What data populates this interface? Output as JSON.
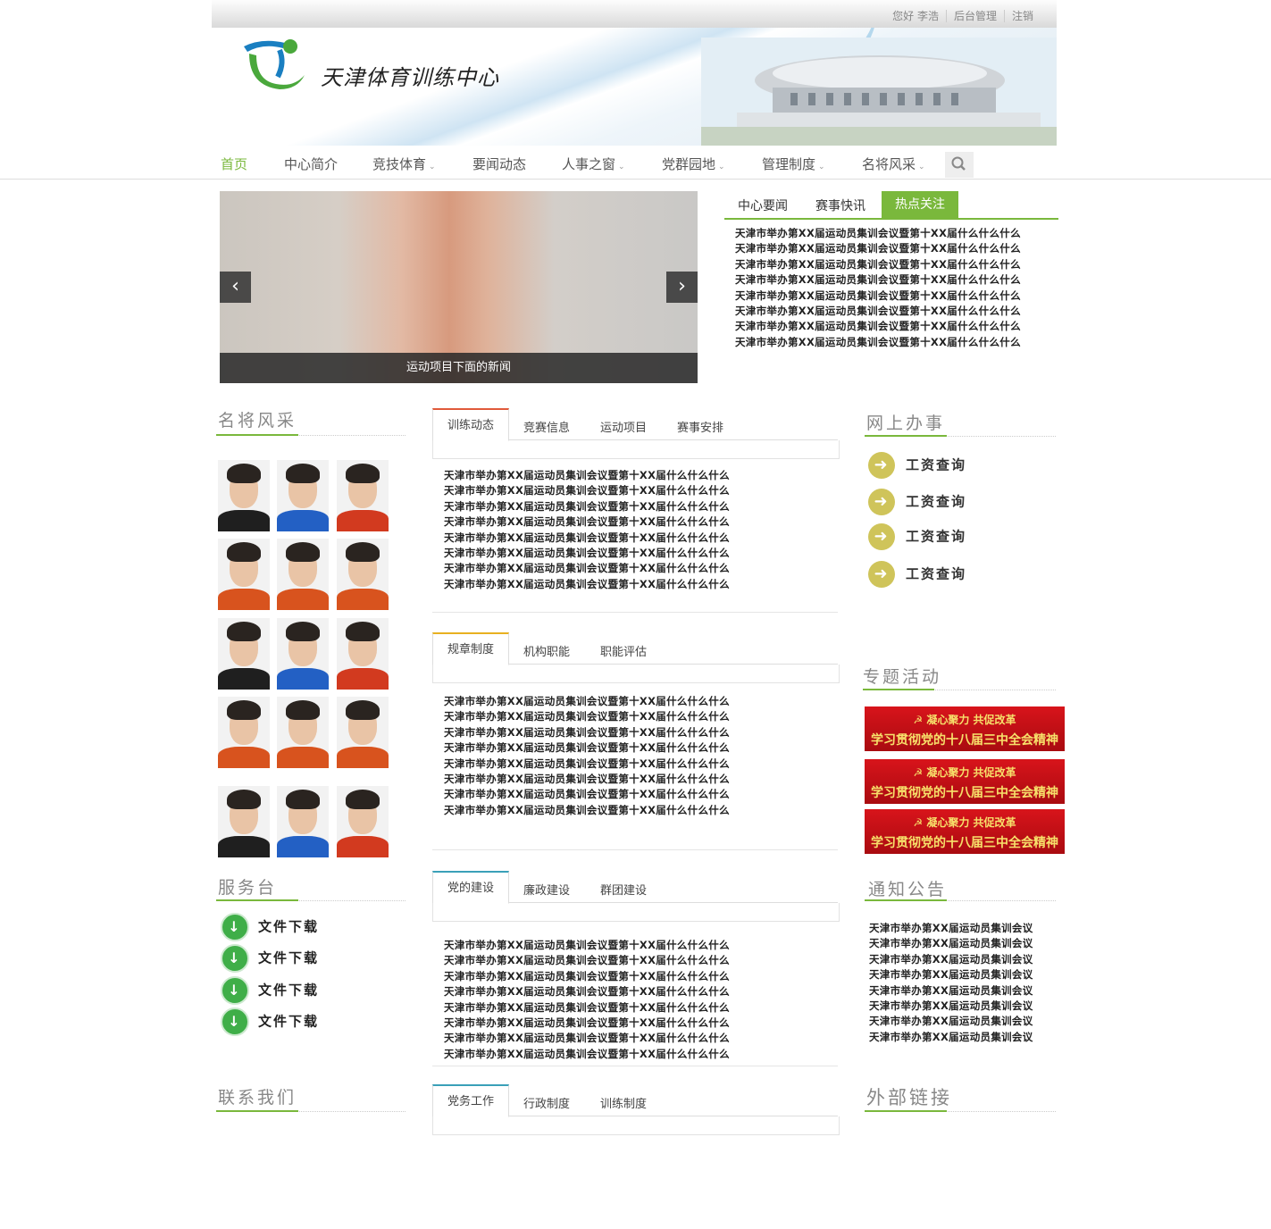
{
  "colors": {
    "accent": "#7ab83c",
    "tab_red": "#e05a3a",
    "tab_yellow": "#e8b020",
    "tab_teal": "#3aa0b8"
  },
  "topbar": {
    "greeting": "您好 李浩",
    "admin": "后台管理",
    "logout": "注销"
  },
  "site": {
    "name": "天津体育训练中心"
  },
  "nav": {
    "items": [
      {
        "label": "首页",
        "caret": false
      },
      {
        "label": "中心简介",
        "caret": false
      },
      {
        "label": "竞技体育",
        "caret": true
      },
      {
        "label": "要闻动态",
        "caret": false
      },
      {
        "label": "人事之窗",
        "caret": true
      },
      {
        "label": "党群园地",
        "caret": true
      },
      {
        "label": "管理制度",
        "caret": true
      },
      {
        "label": "名将风采",
        "caret": true
      }
    ],
    "search_icon": "search-icon"
  },
  "slider": {
    "caption": "运动项目下面的新闻",
    "prev_icon": "chevron-left-icon",
    "next_icon": "chevron-right-icon"
  },
  "news_tabs": {
    "tabs": [
      "中心要闻",
      "赛事快讯",
      "热点关注"
    ],
    "active": 2,
    "items": [
      "天津市举办第XX届运动员集训会议暨第十XX届什么什么什么",
      "天津市举办第XX届运动员集训会议暨第十XX届什么什么什么",
      "天津市举办第XX届运动员集训会议暨第十XX届什么什么什么",
      "天津市举办第XX届运动员集训会议暨第十XX届什么什么什么",
      "天津市举办第XX届运动员集训会议暨第十XX届什么什么什么",
      "天津市举办第XX届运动员集训会议暨第十XX届什么什么什么",
      "天津市举办第XX届运动员集训会议暨第十XX届什么什么什么",
      "天津市举办第XX届运动员集训会议暨第十XX届什么什么什么"
    ]
  },
  "famous": {
    "title": "名将风采"
  },
  "service": {
    "title": "服务台",
    "items": [
      "文件下载",
      "文件下载",
      "文件下载",
      "文件下载"
    ]
  },
  "contact": {
    "title": "联系我们"
  },
  "panels": [
    {
      "tabs": [
        "训练动态",
        "竞赛信息",
        "运动项目",
        "赛事安排"
      ],
      "items": [
        "天津市举办第XX届运动员集训会议暨第十XX届什么什么什么",
        "天津市举办第XX届运动员集训会议暨第十XX届什么什么什么",
        "天津市举办第XX届运动员集训会议暨第十XX届什么什么什么",
        "天津市举办第XX届运动员集训会议暨第十XX届什么什么什么",
        "天津市举办第XX届运动员集训会议暨第十XX届什么什么什么",
        "天津市举办第XX届运动员集训会议暨第十XX届什么什么什么",
        "天津市举办第XX届运动员集训会议暨第十XX届什么什么什么",
        "天津市举办第XX届运动员集训会议暨第十XX届什么什么什么"
      ]
    },
    {
      "tabs": [
        "规章制度",
        "机构职能",
        "职能评估"
      ],
      "items": [
        "天津市举办第XX届运动员集训会议暨第十XX届什么什么什么",
        "天津市举办第XX届运动员集训会议暨第十XX届什么什么什么",
        "天津市举办第XX届运动员集训会议暨第十XX届什么什么什么",
        "天津市举办第XX届运动员集训会议暨第十XX届什么什么什么",
        "天津市举办第XX届运动员集训会议暨第十XX届什么什么什么",
        "天津市举办第XX届运动员集训会议暨第十XX届什么什么什么",
        "天津市举办第XX届运动员集训会议暨第十XX届什么什么什么",
        "天津市举办第XX届运动员集训会议暨第十XX届什么什么什么"
      ]
    },
    {
      "tabs": [
        "党的建设",
        "廉政建设",
        "群团建设"
      ],
      "items": [
        "天津市举办第XX届运动员集训会议暨第十XX届什么什么什么",
        "天津市举办第XX届运动员集训会议暨第十XX届什么什么什么",
        "天津市举办第XX届运动员集训会议暨第十XX届什么什么什么",
        "天津市举办第XX届运动员集训会议暨第十XX届什么什么什么",
        "天津市举办第XX届运动员集训会议暨第十XX届什么什么什么",
        "天津市举办第XX届运动员集训会议暨第十XX届什么什么什么",
        "天津市举办第XX届运动员集训会议暨第十XX届什么什么什么",
        "天津市举办第XX届运动员集训会议暨第十XX届什么什么什么"
      ]
    },
    {
      "tabs": [
        "党务工作",
        "行政制度",
        "训练制度"
      ],
      "items": []
    }
  ],
  "online": {
    "title": "网上办事",
    "items": [
      "工资查询",
      "工资查询",
      "工资查询",
      "工资查询"
    ]
  },
  "special": {
    "title": "专题活动",
    "banners": [
      {
        "line1": "凝心聚力 共促改革",
        "line2": "学习贯彻党的十八届三中全会精神"
      },
      {
        "line1": "凝心聚力 共促改革",
        "line2": "学习贯彻党的十八届三中全会精神"
      },
      {
        "line1": "凝心聚力 共促改革",
        "line2": "学习贯彻党的十八届三中全会精神"
      }
    ]
  },
  "notice": {
    "title": "通知公告",
    "items": [
      "天津市举办第XX届运动员集训会议",
      "天津市举办第XX届运动员集训会议",
      "天津市举办第XX届运动员集训会议",
      "天津市举办第XX届运动员集训会议",
      "天津市举办第XX届运动员集训会议",
      "天津市举办第XX届运动员集训会议",
      "天津市举办第XX届运动员集训会议",
      "天津市举办第XX届运动员集训会议"
    ]
  },
  "links": {
    "title": "外部链接"
  }
}
